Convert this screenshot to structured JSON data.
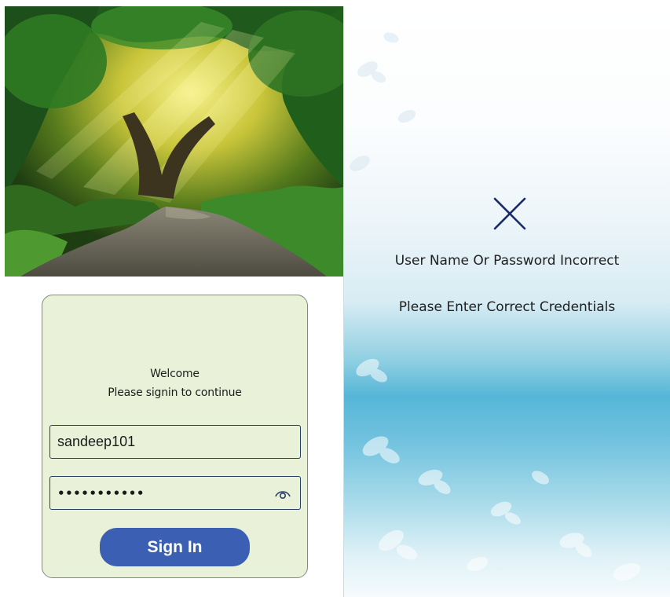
{
  "login": {
    "welcome_line1": "Welcome",
    "welcome_line2": "Please signin to continue",
    "username_value": "sandeep101",
    "password_masked": "•••••••••••",
    "signin_label": "Sign In",
    "icons": {
      "password_toggle": "eye-icon"
    }
  },
  "error_dialog": {
    "icon": "close-icon",
    "message": "User Name Or Password Incorrect",
    "hint": "Please Enter Correct Credentials"
  },
  "colors": {
    "card_bg": "#e9f2d9",
    "button_bg": "#3a5fb3",
    "icon_navy": "#1a2a6c",
    "field_border": "#2a3f66"
  }
}
